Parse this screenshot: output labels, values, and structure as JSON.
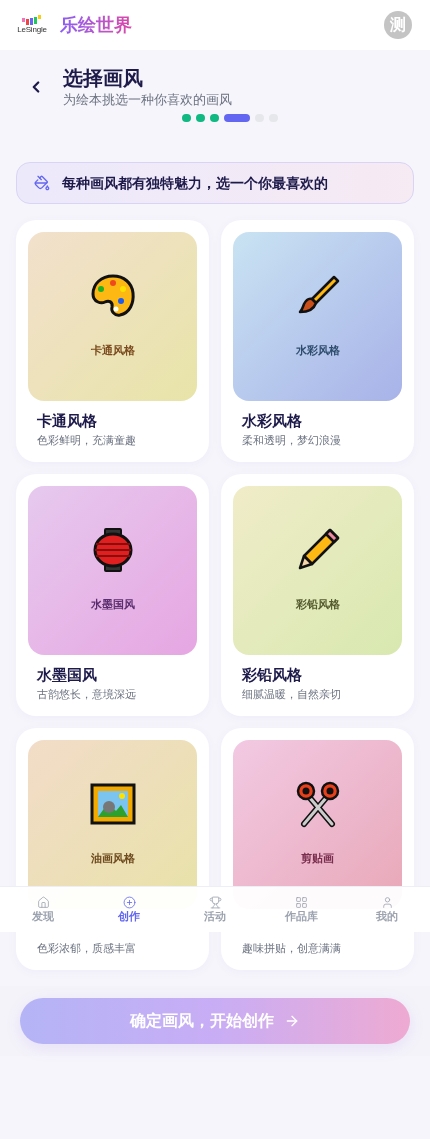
{
  "header": {
    "logo_text": "LeSingle",
    "app_name": "乐绘世界",
    "avatar": "测"
  },
  "page": {
    "title": "选择画风",
    "subtitle": "为绘本挑选一种你喜欢的画风"
  },
  "steps": [
    {
      "completed": true,
      "current": false
    },
    {
      "completed": true,
      "current": false
    },
    {
      "completed": true,
      "current": false
    },
    {
      "completed": false,
      "current": true
    },
    {
      "completed": false,
      "current": false
    },
    {
      "completed": false,
      "current": false
    }
  ],
  "tip": {
    "text": "每种画风都有独特魅力，选一个你最喜欢的"
  },
  "styles": [
    {
      "kind": "cartoon",
      "thumb_label": "卡通风格",
      "name": "卡通风格",
      "desc": "色彩鲜明，充满童趣"
    },
    {
      "kind": "watercolor",
      "thumb_label": "水彩风格",
      "name": "水彩风格",
      "desc": "柔和透明，梦幻浪漫"
    },
    {
      "kind": "ink",
      "thumb_label": "水墨国风",
      "name": "水墨国风",
      "desc": "古韵悠长，意境深远"
    },
    {
      "kind": "pencil",
      "thumb_label": "彩铅风格",
      "name": "彩铅风格",
      "desc": "细腻温暖，自然亲切"
    },
    {
      "kind": "oil",
      "thumb_label": "油画风格",
      "desc": "色彩浓郁，质感丰富"
    },
    {
      "kind": "collage",
      "thumb_label": "剪贴画",
      "desc": "趣味拼贴，创意满满"
    }
  ],
  "confirm_button": "确定画风，开始创作",
  "bottom_nav": [
    {
      "label": "发现",
      "kind": "home",
      "selected": false
    },
    {
      "label": "创作",
      "kind": "create",
      "selected": true
    },
    {
      "label": "活动",
      "kind": "events",
      "selected": false
    },
    {
      "label": "作品库",
      "kind": "gallery",
      "selected": false
    },
    {
      "label": "我的",
      "kind": "profile",
      "selected": false
    }
  ]
}
